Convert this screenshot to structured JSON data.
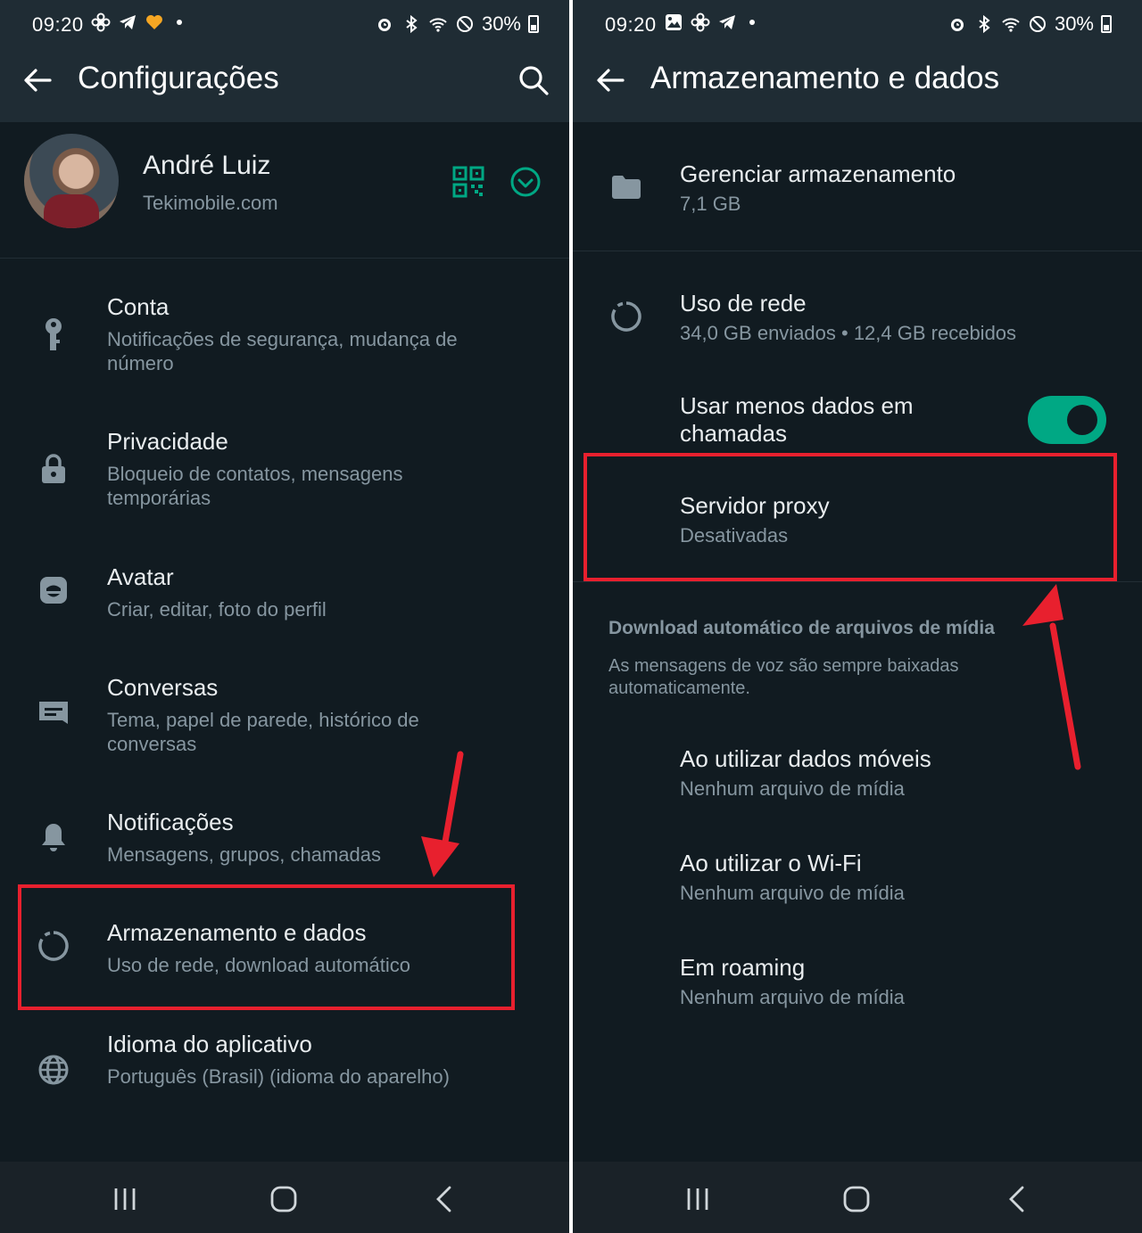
{
  "left": {
    "status": {
      "time": "09:20",
      "battery": "30%"
    },
    "appbar": {
      "title": "Configurações"
    },
    "profile": {
      "name": "André Luiz",
      "status": "Tekimobile.com"
    },
    "items": [
      {
        "title": "Conta",
        "sub": "Notificações de segurança, mudança de número",
        "icon": "key-icon"
      },
      {
        "title": "Privacidade",
        "sub": "Bloqueio de contatos, mensagens temporárias",
        "icon": "lock-icon"
      },
      {
        "title": "Avatar",
        "sub": "Criar, editar, foto do perfil",
        "icon": "avatar-icon"
      },
      {
        "title": "Conversas",
        "sub": "Tema, papel de parede, histórico de conversas",
        "icon": "chat-icon"
      },
      {
        "title": "Notificações",
        "sub": "Mensagens, grupos, chamadas",
        "icon": "bell-icon"
      },
      {
        "title": "Armazenamento e dados",
        "sub": "Uso de rede, download automático",
        "icon": "storage-circle-icon"
      },
      {
        "title": "Idioma do aplicativo",
        "sub": "Português (Brasil) (idioma do aparelho)",
        "icon": "globe-icon"
      }
    ]
  },
  "right": {
    "status": {
      "time": "09:20",
      "battery": "30%"
    },
    "appbar": {
      "title": "Armazenamento e dados"
    },
    "manage": {
      "title": "Gerenciar armazenamento",
      "sub": "7,1 GB"
    },
    "network": {
      "title": "Uso de rede",
      "sub": "34,0 GB enviados • 12,4 GB recebidos"
    },
    "less_data": {
      "title_line1": "Usar menos dados em",
      "title_line2": "chamadas",
      "enabled": true
    },
    "proxy": {
      "title": "Servidor proxy",
      "sub": "Desativadas"
    },
    "autodownload": {
      "header": "Download automático de arquivos de mídia",
      "note": "As mensagens de voz são sempre baixadas automaticamente.",
      "options": [
        {
          "title": "Ao utilizar dados móveis",
          "sub": "Nenhum arquivo de mídia"
        },
        {
          "title": "Ao utilizar o Wi-Fi",
          "sub": "Nenhum arquivo de mídia"
        },
        {
          "title": "Em roaming",
          "sub": "Nenhum arquivo de mídia"
        }
      ]
    }
  },
  "colors": {
    "background": "#111b21",
    "bar": "#1f2c34",
    "accent": "#00a884",
    "highlight": "#e8202e"
  }
}
